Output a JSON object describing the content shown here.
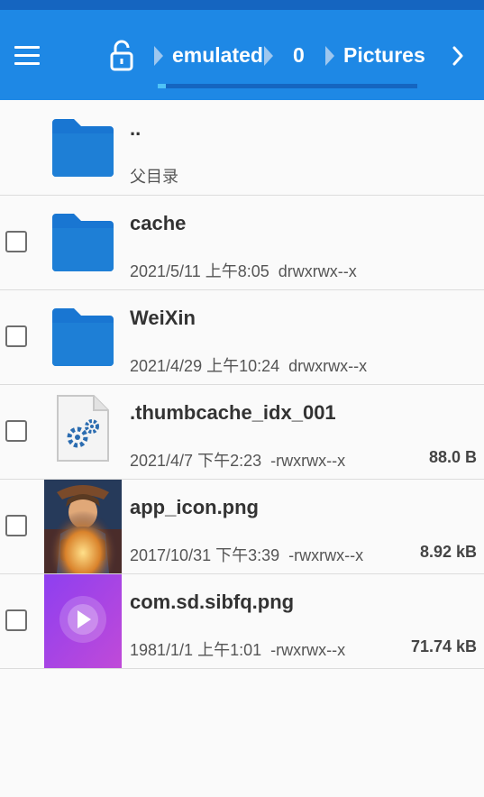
{
  "header": {
    "breadcrumbs": [
      "emulated",
      "0",
      "Pictures"
    ],
    "progress": 0.03,
    "colors": {
      "status_bar": "#1565c0",
      "app_bar": "#1e88e5",
      "folder": "#1976d2"
    }
  },
  "files": [
    {
      "name": "..",
      "subtitle": "父目录",
      "icon": "folder-icon",
      "checkbox": false
    },
    {
      "name": "cache",
      "date": "2021/5/11 上午8:05",
      "perms": "drwxrwx--x",
      "icon": "folder-icon",
      "checkbox": true,
      "checked": false
    },
    {
      "name": "WeiXin",
      "date": "2021/4/29 上午10:24",
      "perms": "drwxrwx--x",
      "icon": "folder-icon",
      "checkbox": true,
      "checked": false
    },
    {
      "name": ".thumbcache_idx_001",
      "date": "2021/4/7 下午2:23",
      "perms": "-rwxrwx--x",
      "size": "88.0 B",
      "icon": "settings-file-icon",
      "checkbox": true,
      "checked": false
    },
    {
      "name": "app_icon.png",
      "date": "2017/10/31 下午3:39",
      "perms": "-rwxrwx--x",
      "size": "8.92 kB",
      "icon": "image-thumbnail",
      "checkbox": true,
      "checked": false
    },
    {
      "name": "com.sd.sibfq.png",
      "date": "1981/1/1 上午1:01",
      "perms": "-rwxrwx--x",
      "size": "71.74 kB",
      "icon": "video-app-thumbnail",
      "checkbox": true,
      "checked": false
    }
  ]
}
